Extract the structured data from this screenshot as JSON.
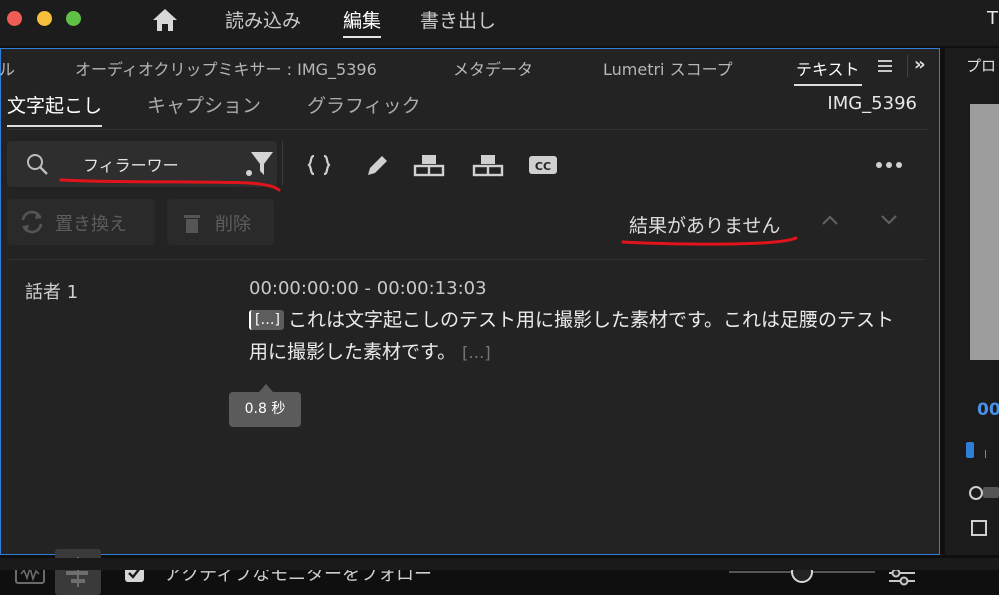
{
  "menubar": {
    "items": [
      "読み込み",
      "編集",
      "書き出し"
    ],
    "active_index": 1,
    "right_text": "T"
  },
  "panel_tabs": {
    "items": [
      "ル",
      "オーディオクリップミキサー : IMG_5396",
      "メタデータ",
      "Lumetri スコープ",
      "テキスト"
    ],
    "active_index": 4,
    "more_icon": "double-chevron-right-icon",
    "menu_icon": "hamburger-menu-icon"
  },
  "subtabs": {
    "items": [
      "文字起こし",
      "キャプション",
      "グラフィック"
    ],
    "active_index": 0,
    "clip_name": "IMG_5396"
  },
  "search": {
    "value": "フィラーワー",
    "icon": "search-icon",
    "filter_icon": "filter-funnel-icon"
  },
  "tools": [
    "split-segment-icon",
    "edit-pencil-icon",
    "merge-up-icon",
    "merge-down-icon",
    "cc-captions-icon"
  ],
  "actions": {
    "replace_label": "置き換え",
    "delete_label": "削除",
    "results_text": "結果がありません"
  },
  "transcript": {
    "speaker": "話者 1",
    "timecode": "00:00:00:00 - 00:00:13:03",
    "pause_marker": "[…]",
    "text": "これは文字起こしのテスト用に撮影した素材です。これは足腰のテスト用に撮影した素材です。",
    "trailing_marker": "[…]",
    "tooltip": "0.8 秒"
  },
  "footer": {
    "follow_label": "アクティブなモニターをフォロー",
    "follow_checked": true
  },
  "right_panel": {
    "label": "プロ",
    "time": "00"
  },
  "colors": {
    "accent": "#2f7fd8",
    "annotation_red": "#e0151b"
  }
}
